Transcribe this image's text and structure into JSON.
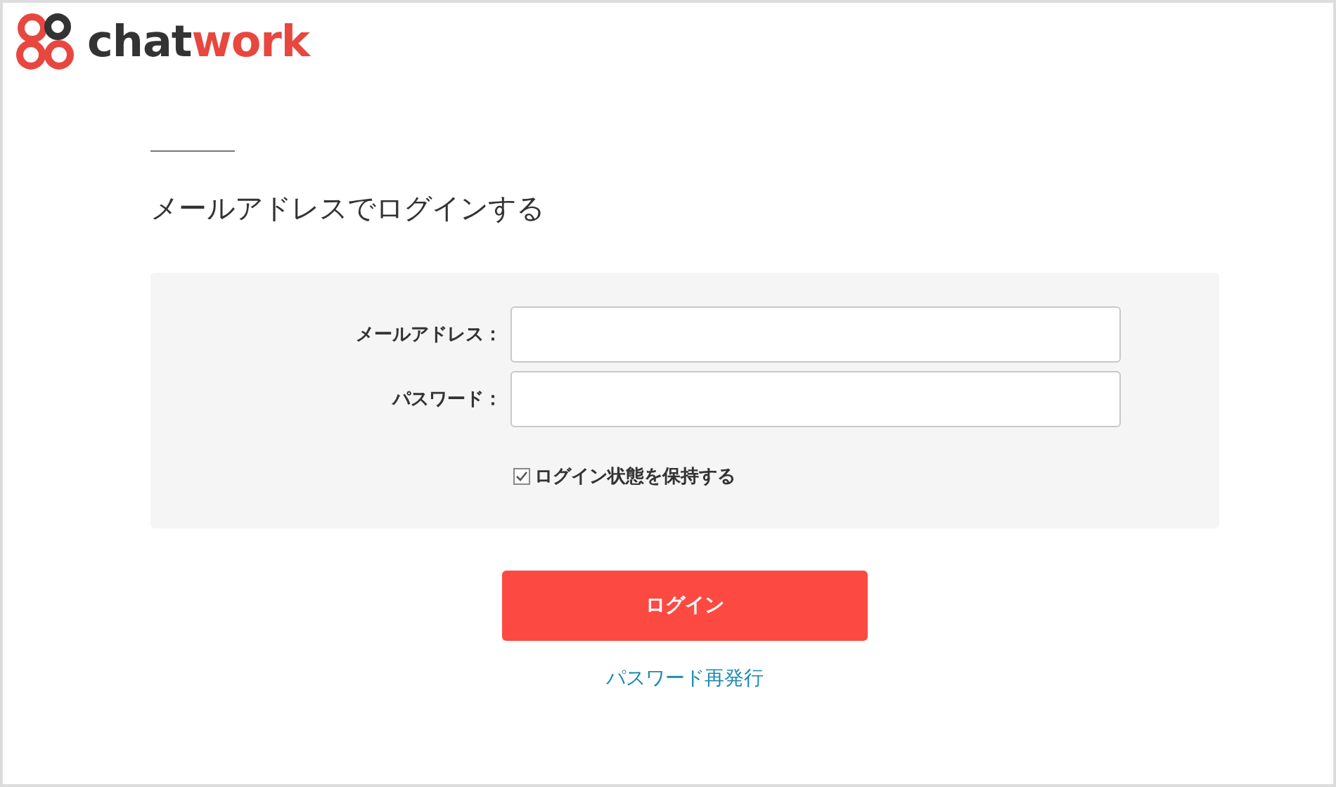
{
  "logo": {
    "text_dark": "chat",
    "text_accent": "work"
  },
  "heading": "メールアドレスでログインする",
  "form": {
    "fields": [
      {
        "label": "メールアドレス："
      },
      {
        "label": "パスワード："
      }
    ],
    "remember": {
      "label": "ログイン状態を保持する",
      "checked": true
    }
  },
  "login_button": "ログイン",
  "reset_link": "パスワード再発行"
}
